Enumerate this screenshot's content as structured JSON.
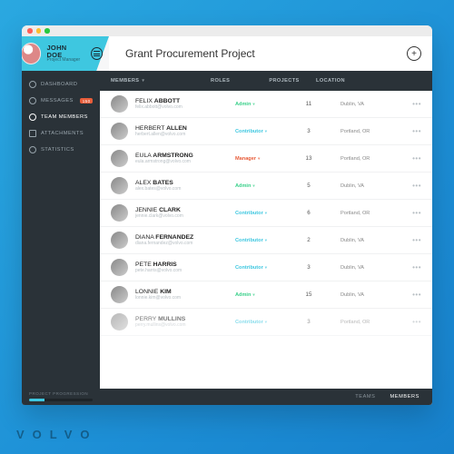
{
  "user": {
    "name": "JOHN DOE",
    "role": "Project Manager"
  },
  "page_title": "Grant Procurement Project",
  "sidebar": {
    "items": [
      {
        "label": "DASHBOARD"
      },
      {
        "label": "MESSAGES",
        "badge": "150"
      },
      {
        "label": "TEAM MEMBERS"
      },
      {
        "label": "ATTACHMENTS"
      },
      {
        "label": "STATISTICS"
      }
    ],
    "footer_label": "PROJECT PROGRESSION"
  },
  "table": {
    "headers": {
      "name": "MEMBERS",
      "role": "ROLES",
      "projects": "PROJECTS",
      "location": "LOCATION"
    },
    "rows": [
      {
        "first": "FELIX",
        "last": "ABBOTT",
        "email": "felix.abbott@volvo.com",
        "role": "Admin",
        "role_class": "role-admin",
        "projects": "11",
        "location": "Dublin, VA"
      },
      {
        "first": "HERBERT",
        "last": "ALLEN",
        "email": "herbert.allen@volvo.com",
        "role": "Contributor",
        "role_class": "role-contrib",
        "projects": "3",
        "location": "Portland, OR"
      },
      {
        "first": "EULA",
        "last": "ARMSTRONG",
        "email": "eula.armstrong@volvo.com",
        "role": "Manager",
        "role_class": "role-manager",
        "projects": "13",
        "location": "Portland, OR"
      },
      {
        "first": "ALEX",
        "last": "BATES",
        "email": "alex.bates@volvo.com",
        "role": "Admin",
        "role_class": "role-admin",
        "projects": "5",
        "location": "Dublin, VA"
      },
      {
        "first": "JENNIE",
        "last": "CLARK",
        "email": "jennie.clark@volvo.com",
        "role": "Contributor",
        "role_class": "role-contrib",
        "projects": "6",
        "location": "Portland, OR"
      },
      {
        "first": "DIANA",
        "last": "FERNANDEZ",
        "email": "diana.fernandez@volvo.com",
        "role": "Contributor",
        "role_class": "role-contrib",
        "projects": "2",
        "location": "Dublin, VA"
      },
      {
        "first": "PETE",
        "last": "HARRIS",
        "email": "pete.harris@volvo.com",
        "role": "Contributor",
        "role_class": "role-contrib",
        "projects": "3",
        "location": "Dublin, VA"
      },
      {
        "first": "LONNIE",
        "last": "KIM",
        "email": "lonnie.kim@volvo.com",
        "role": "Admin",
        "role_class": "role-admin",
        "projects": "15",
        "location": "Dublin, VA"
      },
      {
        "first": "PERRY",
        "last": "MULLINS",
        "email": "perry.mullins@volvo.com",
        "role": "Contributor",
        "role_class": "role-contrib",
        "projects": "3",
        "location": "Portland, OR"
      }
    ]
  },
  "bottom_tabs": {
    "teams": "TEAMS",
    "members": "MEMBERS"
  },
  "brand": "VOLVO"
}
